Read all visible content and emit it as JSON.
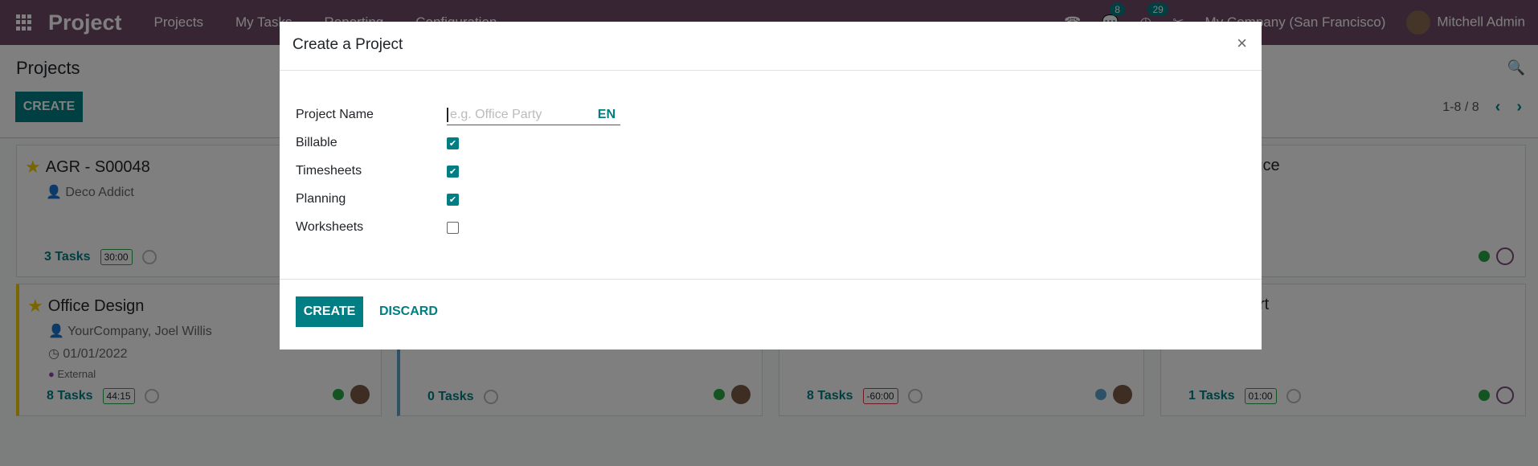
{
  "navbar": {
    "app": "Project",
    "menu": [
      "Projects",
      "My Tasks",
      "Reporting",
      "Configuration"
    ],
    "messages_count": "8",
    "activities_count": "29",
    "company": "My Company (San Francisco)",
    "user": "Mitchell Admin"
  },
  "control_panel": {
    "title": "Projects",
    "create": "CREATE",
    "pager": "1-8 / 8"
  },
  "cards": [
    {
      "title": "AGR - S00048",
      "partner": "Deco Addict",
      "tasks": "3 Tasks",
      "time": "30:00",
      "starred": true
    },
    {
      "title_fragment": "ice"
    },
    {
      "title": "Office Design",
      "partner": "YourCompany, Joel Willis",
      "date": "01/01/2022",
      "tag": "External",
      "tasks": "8 Tasks",
      "time": "44:15",
      "starred": true
    },
    {
      "tasks": "0 Tasks"
    },
    {
      "tasks": "8 Tasks",
      "time": "-60:00"
    },
    {
      "title_fragment": "rt",
      "tasks": "1 Tasks",
      "time": "01:00"
    }
  ],
  "modal": {
    "title": "Create a Project",
    "close": "×",
    "fields": [
      {
        "label": "Project Name",
        "placeholder": "e.g. Office Party",
        "lang": "EN"
      },
      {
        "label": "Billable",
        "checked": true
      },
      {
        "label": "Timesheets",
        "checked": true
      },
      {
        "label": "Planning",
        "checked": true
      },
      {
        "label": "Worksheets",
        "checked": false
      }
    ],
    "create": "CREATE",
    "discard": "DISCARD"
  },
  "colors": {
    "navbar": "#714b67",
    "accent": "#017e84"
  }
}
